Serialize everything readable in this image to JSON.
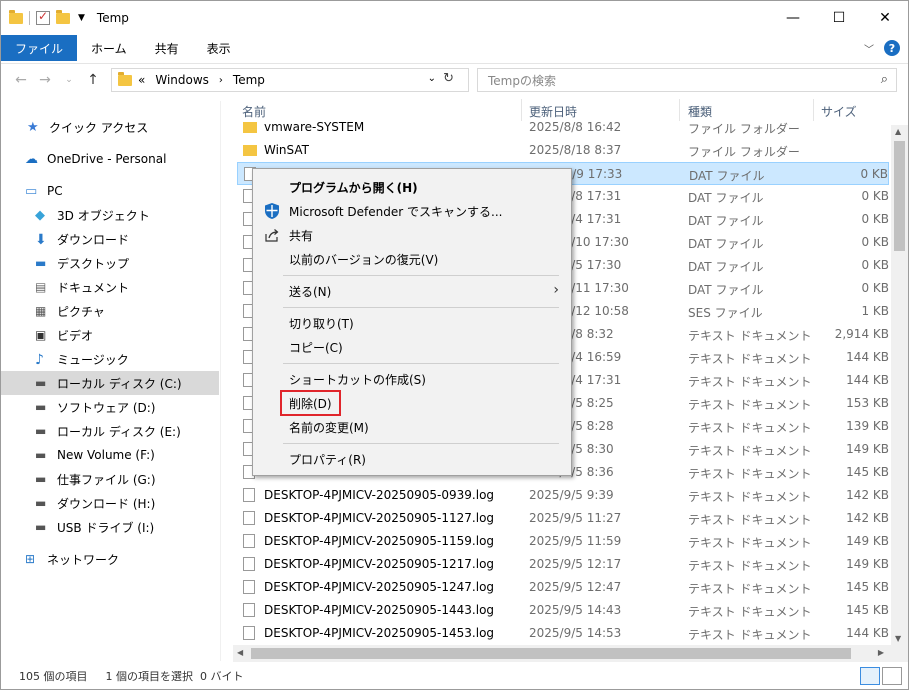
{
  "window": {
    "title": "Temp"
  },
  "ribbon": {
    "tabs": [
      "ファイル",
      "ホーム",
      "共有",
      "表示"
    ]
  },
  "address": {
    "prefix": "«",
    "path": [
      "Windows",
      "Temp"
    ],
    "search_placeholder": "Tempの検索"
  },
  "nav": {
    "items": [
      {
        "label": "クイック アクセス",
        "icon": "star-icon"
      },
      {
        "label": "OneDrive - Personal",
        "icon": "cloud-icon"
      },
      {
        "label": "PC",
        "icon": "pc-icon"
      },
      {
        "label": "3D オブジェクト",
        "icon": "cube-icon"
      },
      {
        "label": "ダウンロード",
        "icon": "download-icon"
      },
      {
        "label": "デスクトップ",
        "icon": "desktop-icon"
      },
      {
        "label": "ドキュメント",
        "icon": "document-icon"
      },
      {
        "label": "ピクチャ",
        "icon": "picture-icon"
      },
      {
        "label": "ビデオ",
        "icon": "video-icon"
      },
      {
        "label": "ミュージック",
        "icon": "music-icon"
      },
      {
        "label": "ローカル ディスク (C:)",
        "icon": "drive-icon"
      },
      {
        "label": "ソフトウェア (D:)",
        "icon": "drive-icon"
      },
      {
        "label": "ローカル ディスク (E:)",
        "icon": "drive-icon"
      },
      {
        "label": "New Volume (F:)",
        "icon": "drive-icon"
      },
      {
        "label": "仕事ファイル (G:)",
        "icon": "drive-icon"
      },
      {
        "label": "ダウンロード (H:)",
        "icon": "drive-icon"
      },
      {
        "label": "USB ドライブ (I:)",
        "icon": "usb-icon"
      },
      {
        "label": "ネットワーク",
        "icon": "network-icon"
      }
    ]
  },
  "columns": {
    "name": "名前",
    "date": "更新日時",
    "type": "種類",
    "size": "サイズ"
  },
  "files": [
    {
      "name": "vmware-SYSTEM",
      "date": "2025/8/8 16:42",
      "type": "ファイル フォルダー",
      "size": "",
      "folder": true
    },
    {
      "name": "WinSAT",
      "date": "2025/8/18 8:37",
      "type": "ファイル フォルダー",
      "size": "",
      "folder": true
    },
    {
      "name": "",
      "date": "2025/9/9 17:33",
      "type": "DAT ファイル",
      "size": "0 KB"
    },
    {
      "name": "",
      "date": "2025/8/8 17:31",
      "type": "DAT ファイル",
      "size": "0 KB"
    },
    {
      "name": "",
      "date": "2025/8/4 17:31",
      "type": "DAT ファイル",
      "size": "0 KB"
    },
    {
      "name": "",
      "date": "2025/7/10 17:30",
      "type": "DAT ファイル",
      "size": "0 KB"
    },
    {
      "name": "",
      "date": "2025/9/5 17:30",
      "type": "DAT ファイル",
      "size": "0 KB"
    },
    {
      "name": "",
      "date": "2025/7/11 17:30",
      "type": "DAT ファイル",
      "size": "0 KB"
    },
    {
      "name": "",
      "date": "2025/8/12 10:58",
      "type": "SES ファイル",
      "size": "1 KB"
    },
    {
      "name": "",
      "date": "2025/8/8 8:32",
      "type": "テキスト ドキュメント",
      "size": "2,914 KB"
    },
    {
      "name": "",
      "date": "2025/8/4 16:59",
      "type": "テキスト ドキュメント",
      "size": "144 KB"
    },
    {
      "name": "",
      "date": "2025/8/4 17:31",
      "type": "テキスト ドキュメント",
      "size": "144 KB"
    },
    {
      "name": "",
      "date": "2025/9/5 8:25",
      "type": "テキスト ドキュメント",
      "size": "153 KB"
    },
    {
      "name": "",
      "date": "2025/9/5 8:28",
      "type": "テキスト ドキュメント",
      "size": "139 KB"
    },
    {
      "name": "",
      "date": "2025/9/5 8:30",
      "type": "テキスト ドキュメント",
      "size": "149 KB"
    },
    {
      "name": "",
      "date": "2025/9/5 8:36",
      "type": "テキスト ドキュメント",
      "size": "145 KB"
    },
    {
      "name": "DESKTOP-4PJMICV-20250905-0939.log",
      "date": "2025/9/5 9:39",
      "type": "テキスト ドキュメント",
      "size": "142 KB"
    },
    {
      "name": "DESKTOP-4PJMICV-20250905-1127.log",
      "date": "2025/9/5 11:27",
      "type": "テキスト ドキュメント",
      "size": "142 KB"
    },
    {
      "name": "DESKTOP-4PJMICV-20250905-1159.log",
      "date": "2025/9/5 11:59",
      "type": "テキスト ドキュメント",
      "size": "149 KB"
    },
    {
      "name": "DESKTOP-4PJMICV-20250905-1217.log",
      "date": "2025/9/5 12:17",
      "type": "テキスト ドキュメント",
      "size": "149 KB"
    },
    {
      "name": "DESKTOP-4PJMICV-20250905-1247.log",
      "date": "2025/9/5 12:47",
      "type": "テキスト ドキュメント",
      "size": "145 KB"
    },
    {
      "name": "DESKTOP-4PJMICV-20250905-1443.log",
      "date": "2025/9/5 14:43",
      "type": "テキスト ドキュメント",
      "size": "145 KB"
    },
    {
      "name": "DESKTOP-4PJMICV-20250905-1453.log",
      "date": "2025/9/5 14:53",
      "type": "テキスト ドキュメント",
      "size": "144 KB"
    }
  ],
  "context_menu": [
    {
      "label": "プログラムから開く(H)",
      "bold": true
    },
    {
      "label": "Microsoft Defender でスキャンする...",
      "icon": "defender-shield-icon"
    },
    {
      "label": "共有",
      "icon": "share-icon"
    },
    {
      "label": "以前のバージョンの復元(V)"
    },
    {
      "sep": true
    },
    {
      "label": "送る(N)",
      "submenu": true
    },
    {
      "sep": true
    },
    {
      "label": "切り取り(T)"
    },
    {
      "label": "コピー(C)"
    },
    {
      "sep": true
    },
    {
      "label": "ショートカットの作成(S)"
    },
    {
      "label": "削除(D)",
      "highlight": true
    },
    {
      "label": "名前の変更(M)"
    },
    {
      "sep": true
    },
    {
      "label": "プロパティ(R)"
    }
  ],
  "status": {
    "count": "105 個の項目",
    "selected": "1 個の項目を選択  0 バイト"
  },
  "colors": {
    "accent": "#1a6ec2",
    "selection": "#cce8ff",
    "highlight_box": "#e0252b"
  }
}
